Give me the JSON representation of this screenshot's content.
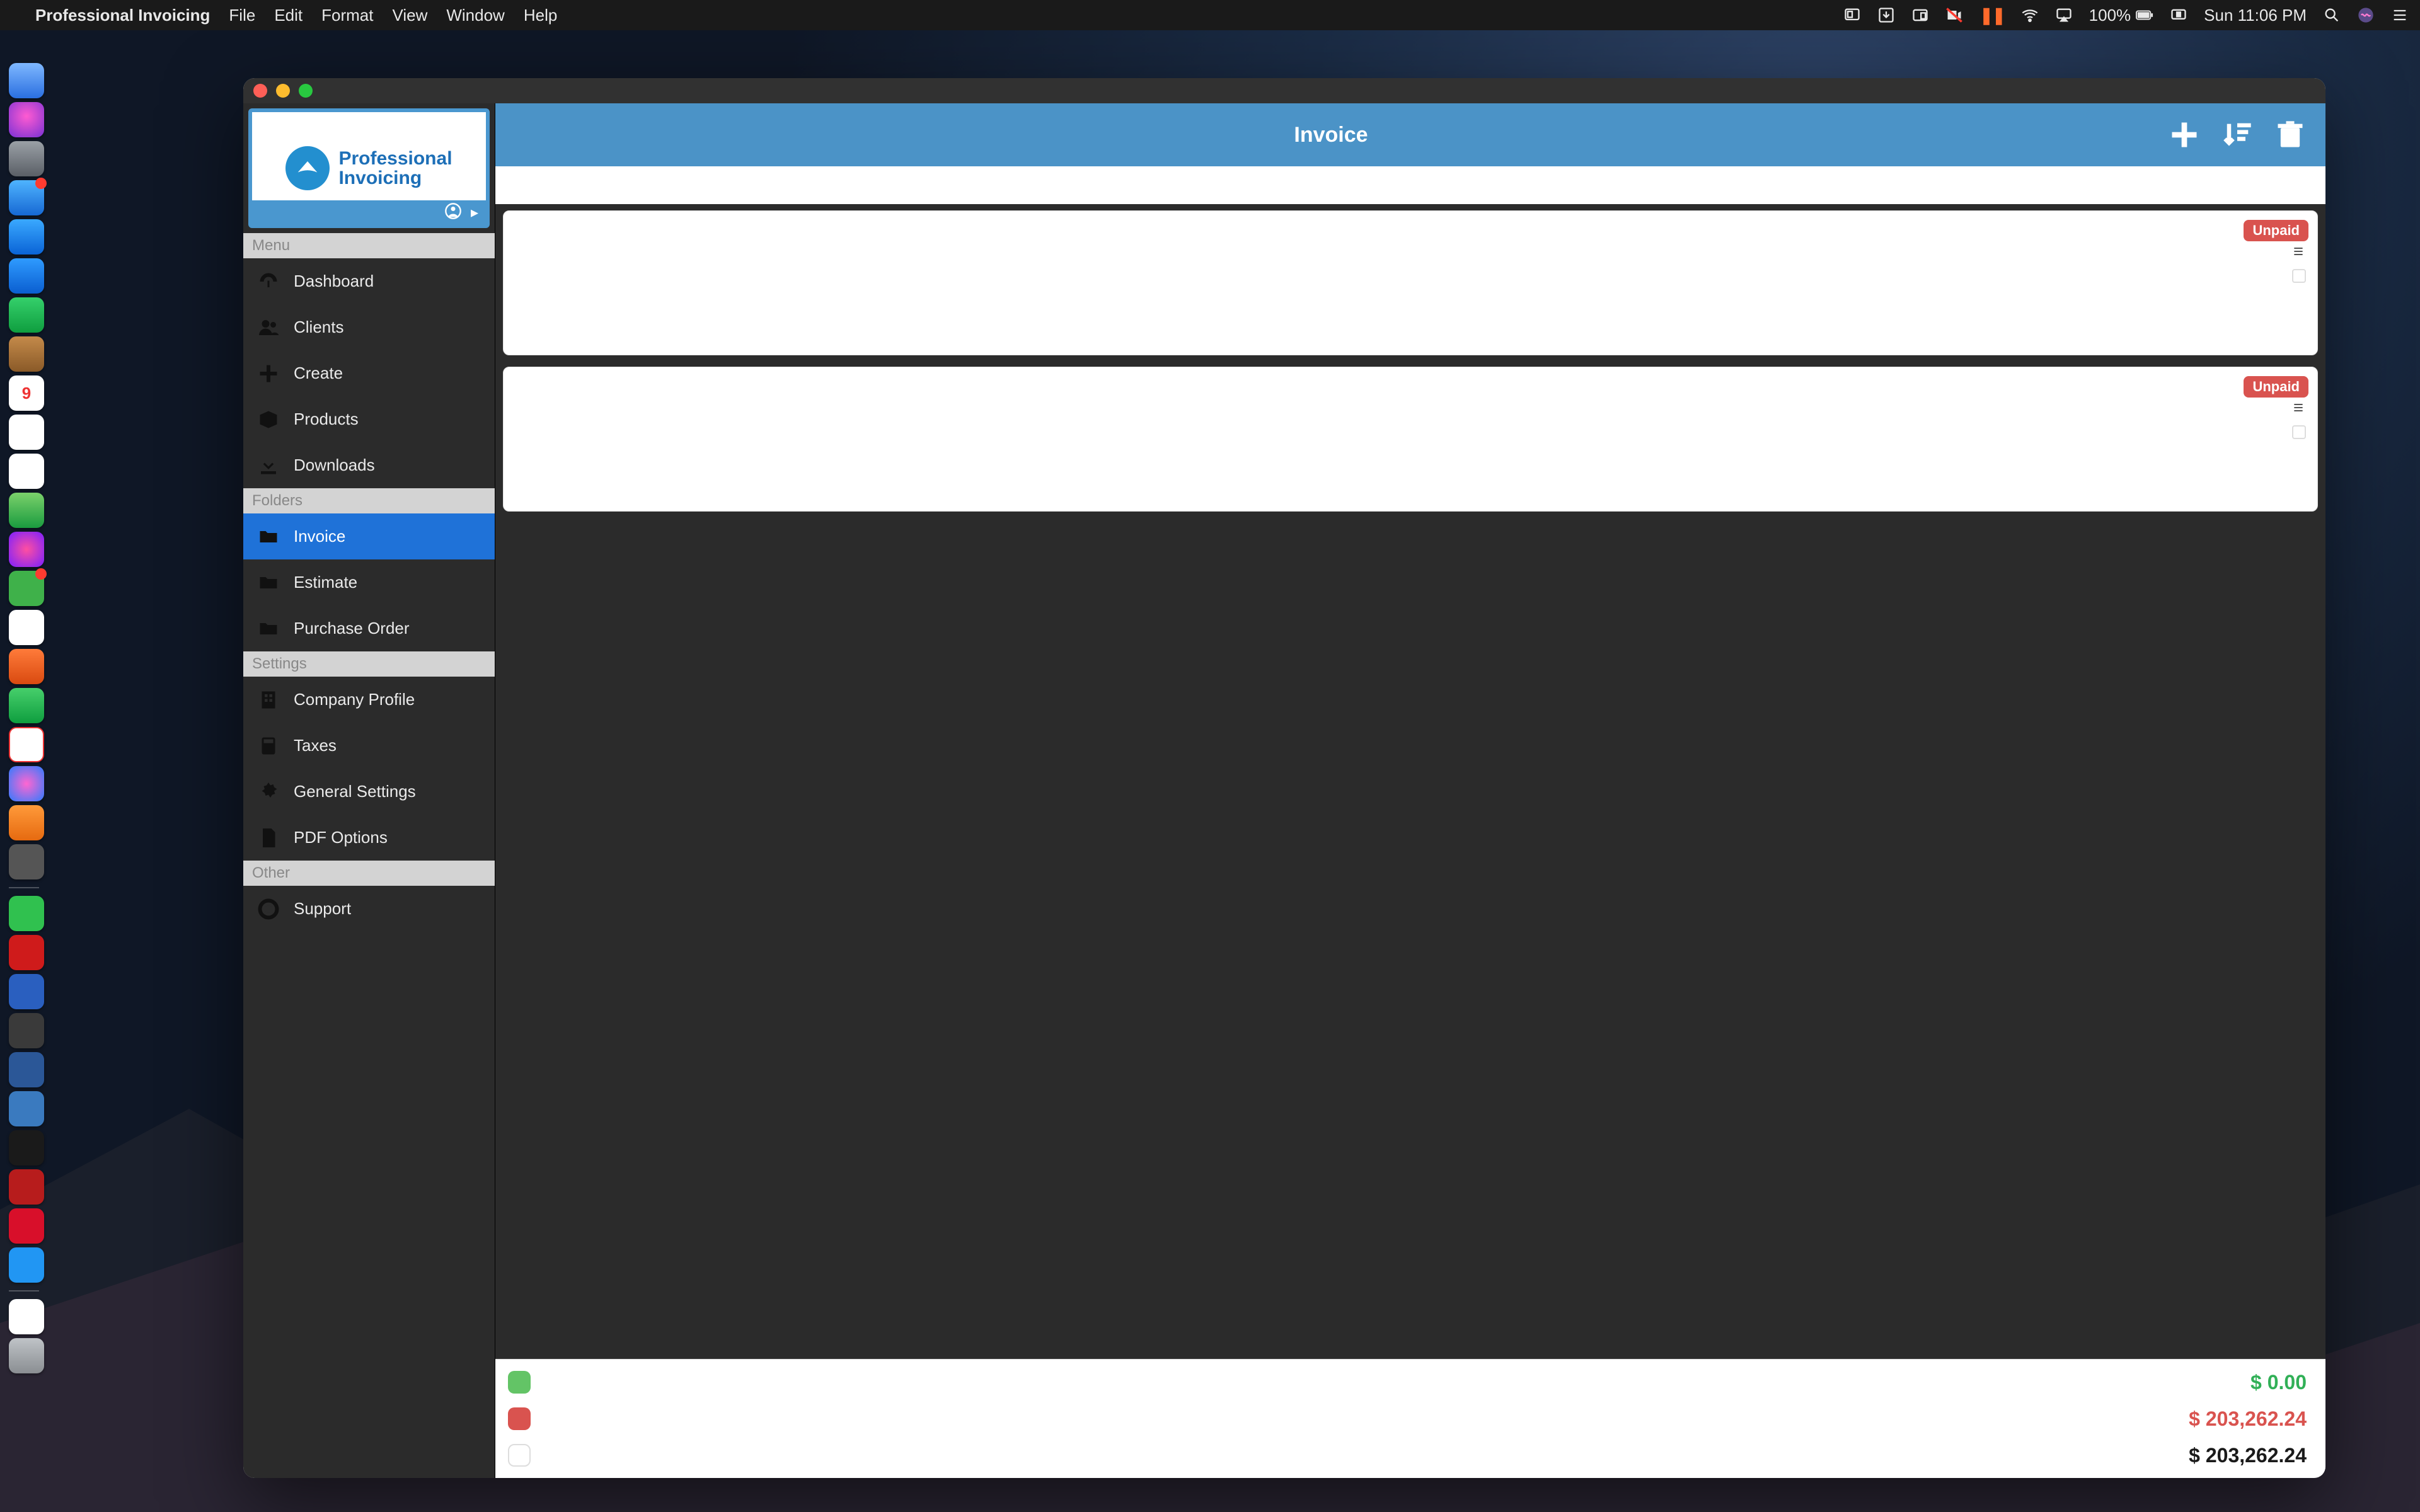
{
  "menubar": {
    "app_name": "Professional Invoicing",
    "items": [
      "File",
      "Edit",
      "Format",
      "View",
      "Window",
      "Help"
    ],
    "battery_pct": "100%",
    "clock": "Sun 11:06 PM"
  },
  "brand": {
    "name1": "Professional",
    "name2": "Invoicing"
  },
  "sidebar": {
    "groups": [
      {
        "title": "Menu",
        "items": [
          {
            "icon": "gauge",
            "label": "Dashboard"
          },
          {
            "icon": "users",
            "label": "Clients"
          },
          {
            "icon": "plus",
            "label": "Create"
          },
          {
            "icon": "box",
            "label": "Products"
          },
          {
            "icon": "download",
            "label": "Downloads"
          }
        ]
      },
      {
        "title": "Folders",
        "items": [
          {
            "icon": "folder",
            "label": "Invoice",
            "active": true
          },
          {
            "icon": "folder",
            "label": "Estimate"
          },
          {
            "icon": "folder",
            "label": "Purchase Order"
          }
        ]
      },
      {
        "title": "Settings",
        "items": [
          {
            "icon": "building",
            "label": "Company Profile"
          },
          {
            "icon": "calc",
            "label": "Taxes"
          },
          {
            "icon": "gear",
            "label": "General Settings"
          },
          {
            "icon": "pdf",
            "label": "PDF Options"
          }
        ]
      },
      {
        "title": "Other",
        "items": [
          {
            "icon": "life-ring",
            "label": "Support"
          }
        ]
      }
    ]
  },
  "toolbar": {
    "title": "Invoice"
  },
  "invoices": [
    {
      "status": "Unpaid"
    },
    {
      "status": "Unpaid"
    }
  ],
  "totals": {
    "paid": {
      "color": "#63c466",
      "value": "$ 0.00"
    },
    "unpaid": {
      "color": "#d9534f",
      "value": "$ 203,262.24"
    },
    "all": {
      "color": "#ffffff",
      "value": "$ 203,262.24"
    }
  },
  "colors": {
    "accent": "#4b93c7",
    "sidebar_active": "#1f72d8",
    "status_unpaid": "#d9534f"
  }
}
